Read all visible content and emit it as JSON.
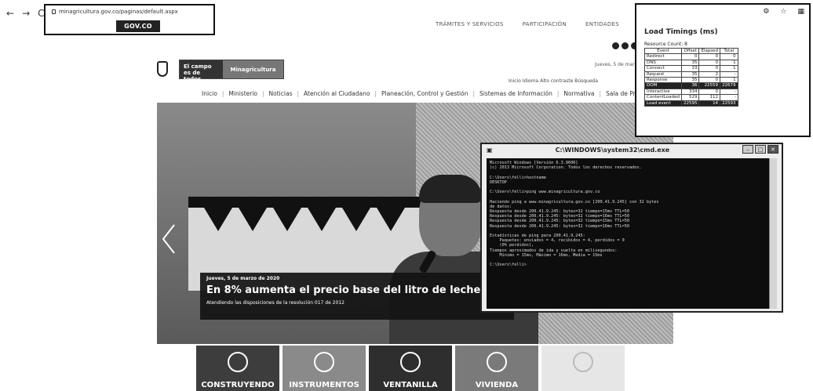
{
  "browser": {
    "back": "←",
    "forward": "→",
    "reload": "C",
    "url": "minagricultura.gov.co/paginas/default.aspx",
    "gov_button": "GOV.CO"
  },
  "site": {
    "top_links": [
      "TRÁMITES Y SERVICIOS",
      "PARTICIPACIÓN",
      "ENTIDADES"
    ],
    "date_line": "Jueves, 5 de marzo de 2020",
    "accessibility": "Inicio   Idioma   Alto contraste   Búsqueda",
    "logo_line1": "El campo",
    "logo_line2": "es de todos",
    "logo_ministry": "Minagricultura",
    "main_nav": [
      "Inicio",
      "Ministerio",
      "Noticias",
      "Atención al Ciudadano",
      "Planeación, Control y Gestión",
      "Sistemas de Información",
      "Normativa",
      "Sala de Prensa"
    ]
  },
  "hero": {
    "date": "Jueves, 5 de marzo de 2020",
    "title": "En 8% aumenta el precio base del litro de leche que se p",
    "subtitle": "Atendiendo las disposiciones de la resolución 017 de 2012"
  },
  "tiles": [
    {
      "label": "CONSTRUYENDO",
      "color": "#3d3d3d"
    },
    {
      "label": "INSTRUMENTOS",
      "color": "#8a8a8a"
    },
    {
      "label": "VENTANILLA",
      "color": "#2e2e2e"
    },
    {
      "label": "VIVIENDA",
      "color": "#7a7a7a"
    },
    {
      "label": "",
      "color": "#e6e6e6"
    }
  ],
  "timings": {
    "title": "Load Timings (ms)",
    "resource_count": "Resource Count: 8",
    "columns": [
      "Event",
      "Offset",
      "Elapsed",
      "Total"
    ],
    "rows": [
      [
        "Redirect",
        "0",
        "0",
        "0"
      ],
      [
        "DNS",
        "35",
        "0",
        "1"
      ],
      [
        "Connect",
        "33",
        "0",
        "1"
      ],
      [
        "Request",
        "35",
        "2",
        "-"
      ],
      [
        "Response",
        "35",
        "0",
        "1"
      ],
      [
        "DOM",
        "36",
        "22559",
        "22679"
      ],
      [
        "Interactive",
        "334",
        "0",
        "-"
      ],
      [
        "ContentLoaded",
        "529",
        "112",
        "-"
      ],
      [
        "Load event",
        "22595",
        "14",
        "22593"
      ]
    ]
  },
  "cmd": {
    "title": "C:\\WINDOWS\\system32\\cmd.exe",
    "lines": [
      "Microsoft Windows [Versión 6.3.9600]",
      "(c) 2013 Microsoft Corporation. Todos los derechos reservados.",
      "",
      "C:\\Users\\felli>hostname",
      "DESKTOP",
      "",
      "C:\\Users\\felli>ping www.minagricultura.gov.co",
      "",
      "Haciendo ping a www.minagricultura.gov.co [200.41.9.245] con 32 bytes",
      "de datos:",
      "Respuesta desde 200.41.9.245: bytes=32 tiempo=15ms TTL=50",
      "Respuesta desde 200.41.9.245: bytes=32 tiempo=16ms TTL=50",
      "Respuesta desde 200.41.9.245: bytes=32 tiempo=15ms TTL=50",
      "Respuesta desde 200.41.9.245: bytes=32 tiempo=16ms TTL=50",
      "",
      "Estadísticas de ping para 200.41.9.245:",
      "    Paquetes: enviados = 4, recibidos = 4, perdidos = 0",
      "    (0% perdidos),",
      "Tiempos aproximados de ida y vuelta en milisegundos:",
      "    Mínimo = 15ms, Máximo = 16ms, Media = 15ms",
      "",
      "C:\\Users\\felli>"
    ]
  }
}
